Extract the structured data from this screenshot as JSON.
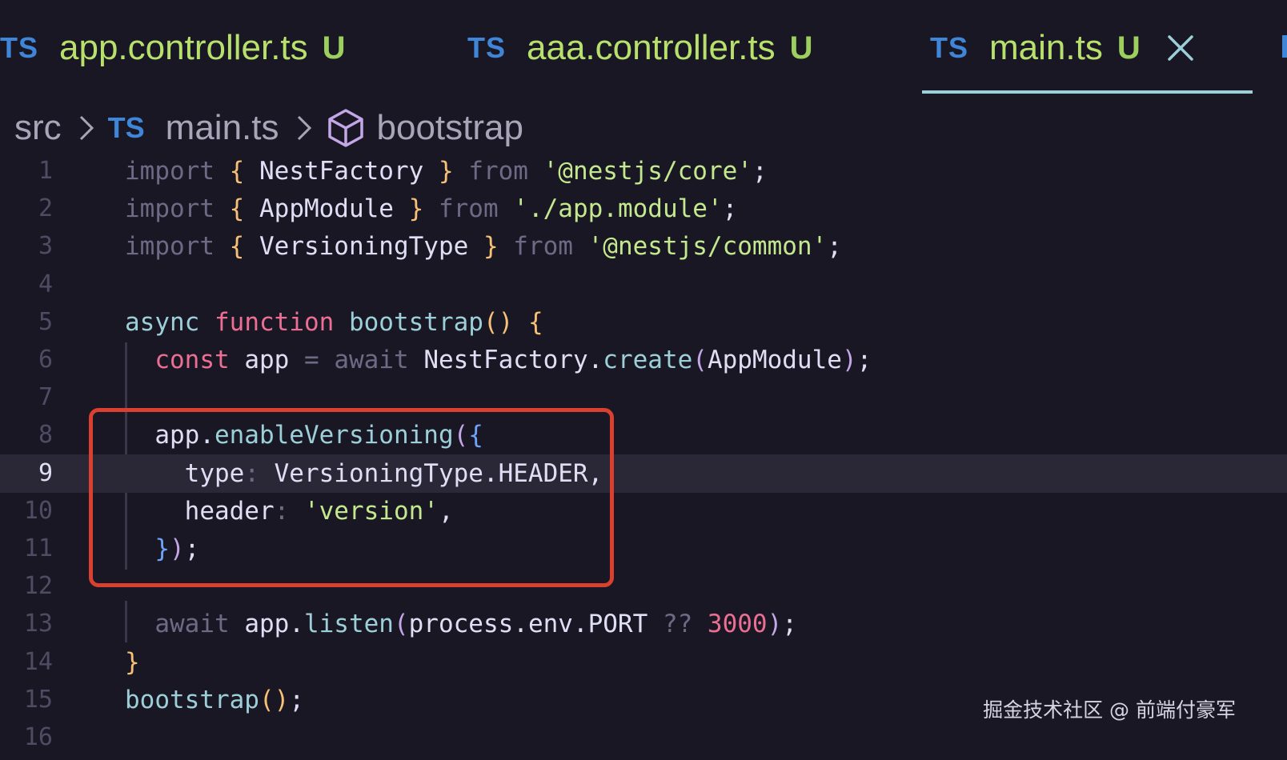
{
  "tabs": [
    {
      "lang": "TS",
      "filename": "app.controller.ts",
      "status": "U",
      "active": false
    },
    {
      "lang": "TS",
      "filename": "aaa.controller.ts",
      "status": "U",
      "active": false
    },
    {
      "lang": "TS",
      "filename": "main.ts",
      "status": "U",
      "active": true
    }
  ],
  "breadcrumb": {
    "folder": "src",
    "lang": "TS",
    "file": "main.ts",
    "symbol": "bootstrap"
  },
  "code_lines": [
    {
      "n": "1",
      "tokens": [
        [
          "import",
          "kw-dim"
        ],
        [
          " ",
          ""
        ],
        [
          "{",
          "brace"
        ],
        [
          " NestFactory ",
          "ident"
        ],
        [
          "}",
          "brace"
        ],
        [
          " ",
          ""
        ],
        [
          "from",
          "kw-dim"
        ],
        [
          " ",
          ""
        ],
        [
          "'@nestjs/core'",
          "str"
        ],
        [
          ";",
          "punct"
        ]
      ]
    },
    {
      "n": "2",
      "tokens": [
        [
          "import",
          "kw-dim"
        ],
        [
          " ",
          ""
        ],
        [
          "{",
          "brace"
        ],
        [
          " AppModule ",
          "ident"
        ],
        [
          "}",
          "brace"
        ],
        [
          " ",
          ""
        ],
        [
          "from",
          "kw-dim"
        ],
        [
          " ",
          ""
        ],
        [
          "'./app.module'",
          "str"
        ],
        [
          ";",
          "punct"
        ]
      ]
    },
    {
      "n": "3",
      "tokens": [
        [
          "import",
          "kw-dim"
        ],
        [
          " ",
          ""
        ],
        [
          "{",
          "brace"
        ],
        [
          " VersioningType ",
          "ident"
        ],
        [
          "}",
          "brace"
        ],
        [
          " ",
          ""
        ],
        [
          "from",
          "kw-dim"
        ],
        [
          " ",
          ""
        ],
        [
          "'@nestjs/common'",
          "str"
        ],
        [
          ";",
          "punct"
        ]
      ]
    },
    {
      "n": "4",
      "tokens": []
    },
    {
      "n": "5",
      "tokens": [
        [
          "async",
          "async"
        ],
        [
          " ",
          ""
        ],
        [
          "function",
          "fn-kw"
        ],
        [
          " ",
          ""
        ],
        [
          "bootstrap",
          "fn-name"
        ],
        [
          "()",
          "paren"
        ],
        [
          " ",
          ""
        ],
        [
          "{",
          "brace"
        ]
      ]
    },
    {
      "n": "6",
      "tokens": [
        [
          "  ",
          ""
        ],
        [
          "const",
          "const"
        ],
        [
          " app ",
          "ident"
        ],
        [
          "=",
          "op"
        ],
        [
          " ",
          ""
        ],
        [
          "await",
          "kw-dim"
        ],
        [
          " NestFactory.",
          "ident"
        ],
        [
          "create",
          "method"
        ],
        [
          "(",
          "paren2"
        ],
        [
          "AppModule",
          "ident"
        ],
        [
          ")",
          "paren2"
        ],
        [
          ";",
          "punct"
        ]
      ]
    },
    {
      "n": "7",
      "tokens": []
    },
    {
      "n": "8",
      "tokens": [
        [
          "  app.",
          "ident"
        ],
        [
          "enableVersioning",
          "method"
        ],
        [
          "(",
          "paren2"
        ],
        [
          "{",
          "paren3"
        ]
      ]
    },
    {
      "n": "9",
      "tokens": [
        [
          "    type",
          "prop"
        ],
        [
          ": ",
          "op"
        ],
        [
          "VersioningType.HEADER,",
          "ident"
        ]
      ]
    },
    {
      "n": "10",
      "tokens": [
        [
          "    header",
          "prop"
        ],
        [
          ": ",
          "op"
        ],
        [
          "'version'",
          "str"
        ],
        [
          ",",
          "punct"
        ]
      ]
    },
    {
      "n": "11",
      "tokens": [
        [
          "  ",
          ""
        ],
        [
          "}",
          "paren3"
        ],
        [
          ")",
          "paren2"
        ],
        [
          ";",
          "punct"
        ]
      ]
    },
    {
      "n": "12",
      "tokens": []
    },
    {
      "n": "13",
      "tokens": [
        [
          "  ",
          ""
        ],
        [
          "await",
          "kw-dim"
        ],
        [
          " app.",
          "ident"
        ],
        [
          "listen",
          "method"
        ],
        [
          "(",
          "paren2"
        ],
        [
          "process.env.PORT ",
          "ident"
        ],
        [
          "??",
          "op"
        ],
        [
          " ",
          ""
        ],
        [
          "3000",
          "num"
        ],
        [
          ")",
          "paren2"
        ],
        [
          ";",
          "punct"
        ]
      ]
    },
    {
      "n": "14",
      "tokens": [
        [
          "}",
          "brace"
        ]
      ]
    },
    {
      "n": "15",
      "tokens": [
        [
          "bootstrap",
          "fn-name"
        ],
        [
          "()",
          "paren"
        ],
        [
          ";",
          "punct"
        ]
      ]
    },
    {
      "n": "16",
      "tokens": []
    }
  ],
  "active_line": "9",
  "watermark": "掘金技术社区 @ 前端付豪军",
  "colors": {
    "background": "#191724",
    "ts_badge": "#3f86d8",
    "tab_filename": "#b8e06c",
    "tab_status": "#9ccf5d",
    "active_tab_underline": "#9ccfd8",
    "highlight_box": "#d9402f",
    "current_line": "#2a2737"
  },
  "icons": {
    "tab_close": "close-icon",
    "breadcrumb_separator": "chevron-right-icon",
    "symbol": "cube-symbol-icon"
  }
}
